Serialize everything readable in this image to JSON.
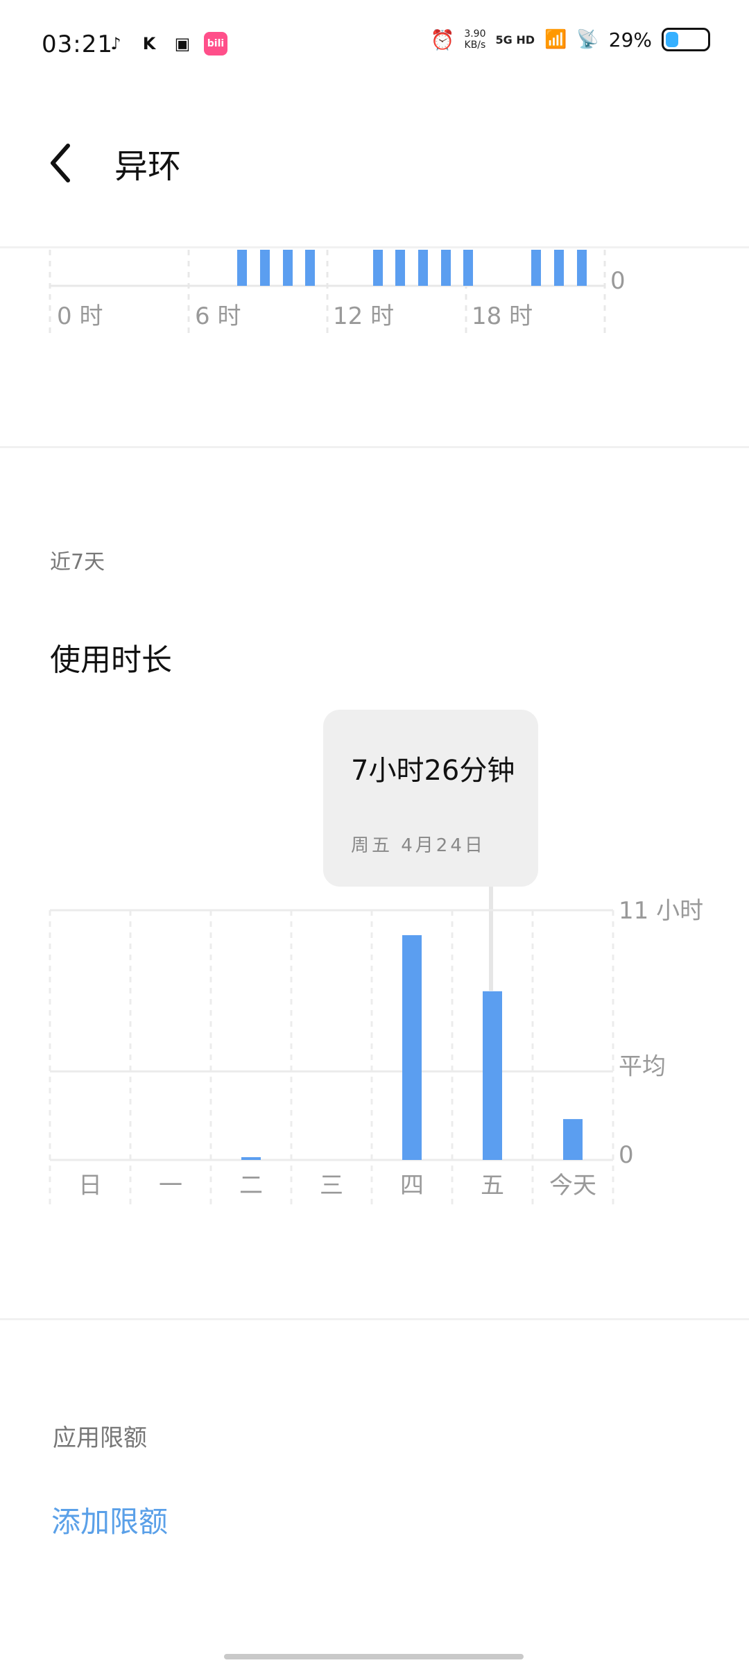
{
  "status_bar": {
    "time": "03:21",
    "speed_value": "3.90",
    "speed_unit": "KB/s",
    "network": "5G HD",
    "battery_percent": "29%"
  },
  "header": {
    "title": "异环"
  },
  "hourly_chart": {
    "x_ticks": [
      "0 时",
      "6 时",
      "12 时",
      "18 时"
    ],
    "y_label_bottom": "0"
  },
  "weekly": {
    "section_label": "近7天",
    "title": "使用时长"
  },
  "tooltip": {
    "main": "7小时26分钟",
    "sub": "周五 4月24日"
  },
  "chart_data": {
    "type": "bar",
    "categories": [
      "日",
      "一",
      "二",
      "三",
      "四",
      "五",
      "今天"
    ],
    "values": [
      0,
      0,
      0.1,
      0,
      9.9,
      7.43,
      1.8
    ],
    "y_labels": {
      "top": "11 小时",
      "avg": "平均",
      "bottom": "0"
    },
    "ylim": [
      0,
      11
    ],
    "avg_value": 3.9,
    "bar_color": "#5b9ef0"
  },
  "app_limit": {
    "label": "应用限额",
    "add_button": "添加限额"
  }
}
